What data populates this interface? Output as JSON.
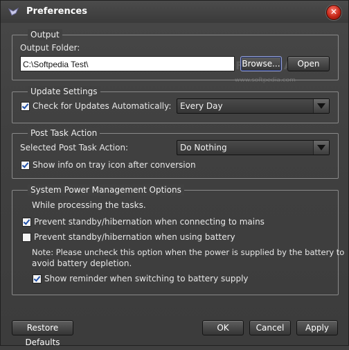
{
  "window": {
    "title": "Preferences",
    "close_glyph": "✕"
  },
  "output": {
    "title": "Output",
    "folder_label": "Output Folder:",
    "folder_value": "C:\\Softpedia Test\\",
    "browse_label": "Browse...",
    "open_label": "Open"
  },
  "update": {
    "title": "Update Settings",
    "check_label": "Check for Updates Automatically:",
    "check_checked": true,
    "frequency_value": "Every Day"
  },
  "post_task": {
    "title": "Post Task Action",
    "action_label": "Selected Post Task Action:",
    "action_value": "Do Nothing",
    "tray_label": "Show info on tray icon after conversion",
    "tray_checked": true
  },
  "power": {
    "title": "System Power Management Options",
    "intro": "While processing the tasks.",
    "mains_label": "Prevent standby/hibernation when connecting to mains",
    "mains_checked": true,
    "battery_label": "Prevent standby/hibernation when using battery",
    "battery_checked": false,
    "note_line1": "Note: Please uncheck this option when the power is supplied by the battery to",
    "note_line2": "avoid battery depletion.",
    "reminder_label": "Show reminder when switching to battery supply",
    "reminder_checked": true
  },
  "footer": {
    "restore_label": "Restore Defaults",
    "ok_label": "OK",
    "cancel_label": "Cancel",
    "apply_label": "Apply"
  },
  "watermark": {
    "text": "SOFTPEDIA",
    "sub": "www.softpedia.com"
  }
}
